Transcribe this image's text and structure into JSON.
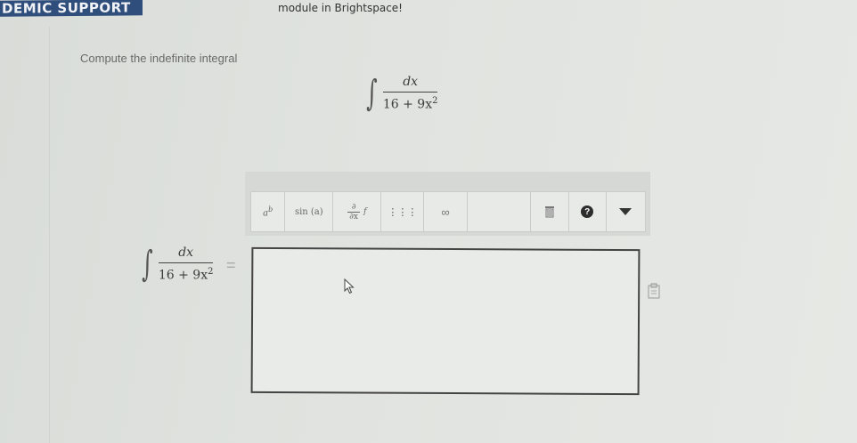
{
  "header": {
    "banner": "DEMIC SUPPORT",
    "module_text": "module in Brightspace!"
  },
  "question": {
    "prompt": "Compute the indefinite integral",
    "integral_sign": "∫",
    "numerator": "dx",
    "denominator_base": "16 + 9x",
    "denominator_exp": "2"
  },
  "toolbar": {
    "power": {
      "base": "a",
      "exp": "b"
    },
    "sin_label": "sin (a)",
    "deriv_top": "∂",
    "deriv_bottom": "∂x",
    "deriv_f": "f",
    "matrix_glyph": "⋮⋮⋮",
    "infinity": "∞",
    "help_glyph": "?"
  },
  "answer": {
    "integral_sign": "∫",
    "numerator": "dx",
    "denominator_base": "16 + 9x",
    "denominator_exp": "2",
    "equals": "=",
    "value": ""
  },
  "colors": {
    "banner": "#2f4e7c",
    "background": "#e1e3e0"
  }
}
